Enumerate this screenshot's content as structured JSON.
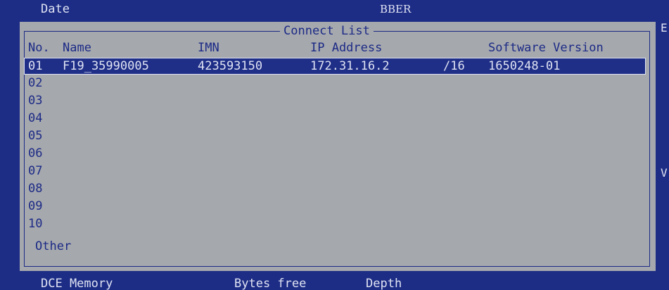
{
  "topbar": {
    "date_label": "Date",
    "title": "BBER"
  },
  "edges": {
    "right_top": "E",
    "right_mid": "V"
  },
  "panel": {
    "title": "Connect List",
    "columns": {
      "no": "No.",
      "name": "Name",
      "imn": "IMN",
      "ip": "IP Address",
      "sw": "Software Version"
    },
    "rows": [
      {
        "no": "01",
        "name": "F19_35990005",
        "imn": "423593150",
        "ip": "172.31.16.2",
        "mask": "/16",
        "sw": "1650248-01"
      },
      {
        "no": "02",
        "name": "",
        "imn": "",
        "ip": "",
        "mask": "",
        "sw": ""
      },
      {
        "no": "03",
        "name": "",
        "imn": "",
        "ip": "",
        "mask": "",
        "sw": ""
      },
      {
        "no": "04",
        "name": "",
        "imn": "",
        "ip": "",
        "mask": "",
        "sw": ""
      },
      {
        "no": "05",
        "name": "",
        "imn": "",
        "ip": "",
        "mask": "",
        "sw": ""
      },
      {
        "no": "06",
        "name": "",
        "imn": "",
        "ip": "",
        "mask": "",
        "sw": ""
      },
      {
        "no": "07",
        "name": "",
        "imn": "",
        "ip": "",
        "mask": "",
        "sw": ""
      },
      {
        "no": "08",
        "name": "",
        "imn": "",
        "ip": "",
        "mask": "",
        "sw": ""
      },
      {
        "no": "09",
        "name": "",
        "imn": "",
        "ip": "",
        "mask": "",
        "sw": ""
      },
      {
        "no": "10",
        "name": "",
        "imn": "",
        "ip": "",
        "mask": "",
        "sw": ""
      }
    ],
    "selected_index": 0,
    "other_label": "Other"
  },
  "bottombar": {
    "memory_label": "DCE Memory",
    "bytes_free_label": "Bytes free",
    "depth_label": "Depth"
  },
  "colors": {
    "screen_bg": "#1d2d85",
    "panel_bg": "#a5a8ad",
    "text_dark": "#1c2a86",
    "text_light": "#dfe3f3",
    "selection_bg": "#1f2f87"
  }
}
